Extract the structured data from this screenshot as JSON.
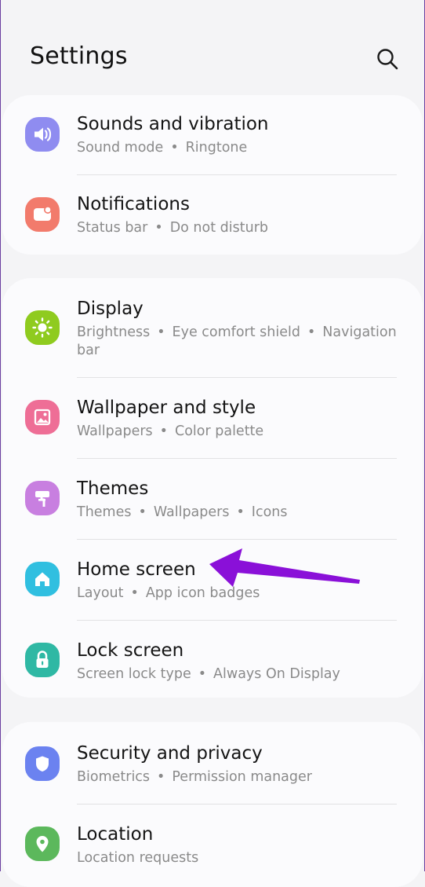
{
  "header": {
    "title": "Settings",
    "search_icon": "search-icon"
  },
  "groups": [
    {
      "items": [
        {
          "title": "Sounds and vibration",
          "subs": [
            "Sound mode",
            "Ringtone"
          ],
          "icon": "volume-icon",
          "color": "#8f8cf0"
        },
        {
          "title": "Notifications",
          "subs": [
            "Status bar",
            "Do not disturb"
          ],
          "icon": "notification-icon",
          "color": "#f27b6c"
        }
      ]
    },
    {
      "items": [
        {
          "title": "Display",
          "subs": [
            "Brightness",
            "Eye comfort shield",
            "Navigation bar"
          ],
          "icon": "sun-icon",
          "color": "#8fcb1f"
        },
        {
          "title": "Wallpaper and style",
          "subs": [
            "Wallpapers",
            "Color palette"
          ],
          "icon": "image-icon",
          "color": "#ee6e96"
        },
        {
          "title": "Themes",
          "subs": [
            "Themes",
            "Wallpapers",
            "Icons"
          ],
          "icon": "paint-roller-icon",
          "color": "#c87fe0"
        },
        {
          "title": "Home screen",
          "subs": [
            "Layout",
            "App icon badges"
          ],
          "icon": "home-icon",
          "color": "#30bfe0"
        },
        {
          "title": "Lock screen",
          "subs": [
            "Screen lock type",
            "Always On Display"
          ],
          "icon": "lock-icon",
          "color": "#2fb8a4"
        }
      ]
    },
    {
      "items": [
        {
          "title": "Security and privacy",
          "subs": [
            "Biometrics",
            "Permission manager"
          ],
          "icon": "shield-icon",
          "color": "#6b82f0"
        },
        {
          "title": "Location",
          "subs": [
            "Location requests"
          ],
          "icon": "location-pin-icon",
          "color": "#5cb85c"
        }
      ]
    }
  ],
  "annotation": {
    "arrow_color": "#8a10d8",
    "target": "Home screen"
  }
}
